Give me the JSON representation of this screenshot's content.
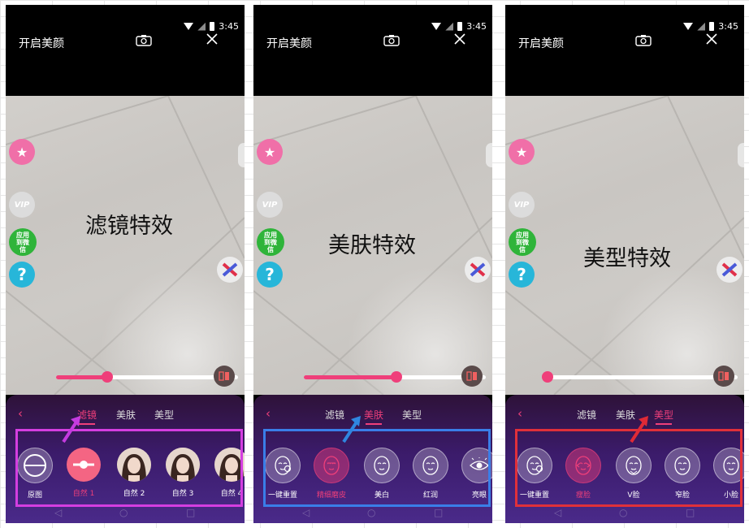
{
  "panels": [
    {
      "title": "开启美颜",
      "time": "3:45",
      "effect_label": "滤镜特效",
      "side": {
        "vip": "VIP",
        "wechat": "应用到微信",
        "help": "?"
      },
      "slider_value": 0.28,
      "tabs": [
        "滤镜",
        "美肤",
        "美型"
      ],
      "active_tab": 0,
      "items": [
        {
          "label": "原图",
          "style": "ghost",
          "icon": "circle-minus-icon"
        },
        {
          "label": "自然 1",
          "style": "selpink",
          "icon": "slider-icon",
          "selected": true
        },
        {
          "label": "自然 2",
          "style": "photo",
          "icon": "portrait-thumbnail"
        },
        {
          "label": "自然 3",
          "style": "photo",
          "icon": "portrait-thumbnail"
        },
        {
          "label": "自然 4",
          "style": "photo",
          "icon": "portrait-thumbnail"
        }
      ],
      "highlight_color": "#d43ee0",
      "arrow_color": "#c53be0"
    },
    {
      "title": "开启美颜",
      "time": "3:45",
      "effect_label": "美肤特效",
      "side": {
        "vip": "VIP",
        "wechat": "应用到微信",
        "help": "?"
      },
      "slider_value": 0.51,
      "tabs": [
        "滤镜",
        "美肤",
        "美型"
      ],
      "active_tab": 1,
      "items": [
        {
          "label": "一键重置",
          "style": "ghost",
          "icon": "face-reset-icon"
        },
        {
          "label": "精细磨皮",
          "style": "pink",
          "icon": "face-smooth-icon",
          "selected": true
        },
        {
          "label": "美白",
          "style": "ghost",
          "icon": "face-whiten-icon"
        },
        {
          "label": "红润",
          "style": "ghost",
          "icon": "face-rosy-icon"
        },
        {
          "label": "亮眼",
          "style": "ghost",
          "icon": "eye-icon"
        }
      ],
      "highlight_color": "#3a7ee8",
      "arrow_color": "#2f86e0"
    },
    {
      "title": "开启美颜",
      "time": "3:45",
      "effect_label": "美型特效",
      "side": {
        "vip": "VIP",
        "wechat": "应用到微信",
        "help": "?"
      },
      "slider_value": 0.0,
      "tabs": [
        "滤镜",
        "美肤",
        "美型"
      ],
      "active_tab": 2,
      "items": [
        {
          "label": "一键重置",
          "style": "ghost",
          "icon": "face-reset-icon"
        },
        {
          "label": "瘦脸",
          "style": "pink",
          "icon": "face-slim-icon",
          "selected": true
        },
        {
          "label": "V脸",
          "style": "ghost",
          "icon": "face-v-icon"
        },
        {
          "label": "窄脸",
          "style": "ghost",
          "icon": "face-narrow-icon"
        },
        {
          "label": "小脸",
          "style": "ghost",
          "icon": "face-small-icon"
        }
      ],
      "highlight_color": "#e0303a",
      "arrow_color": "#e02a36"
    }
  ]
}
